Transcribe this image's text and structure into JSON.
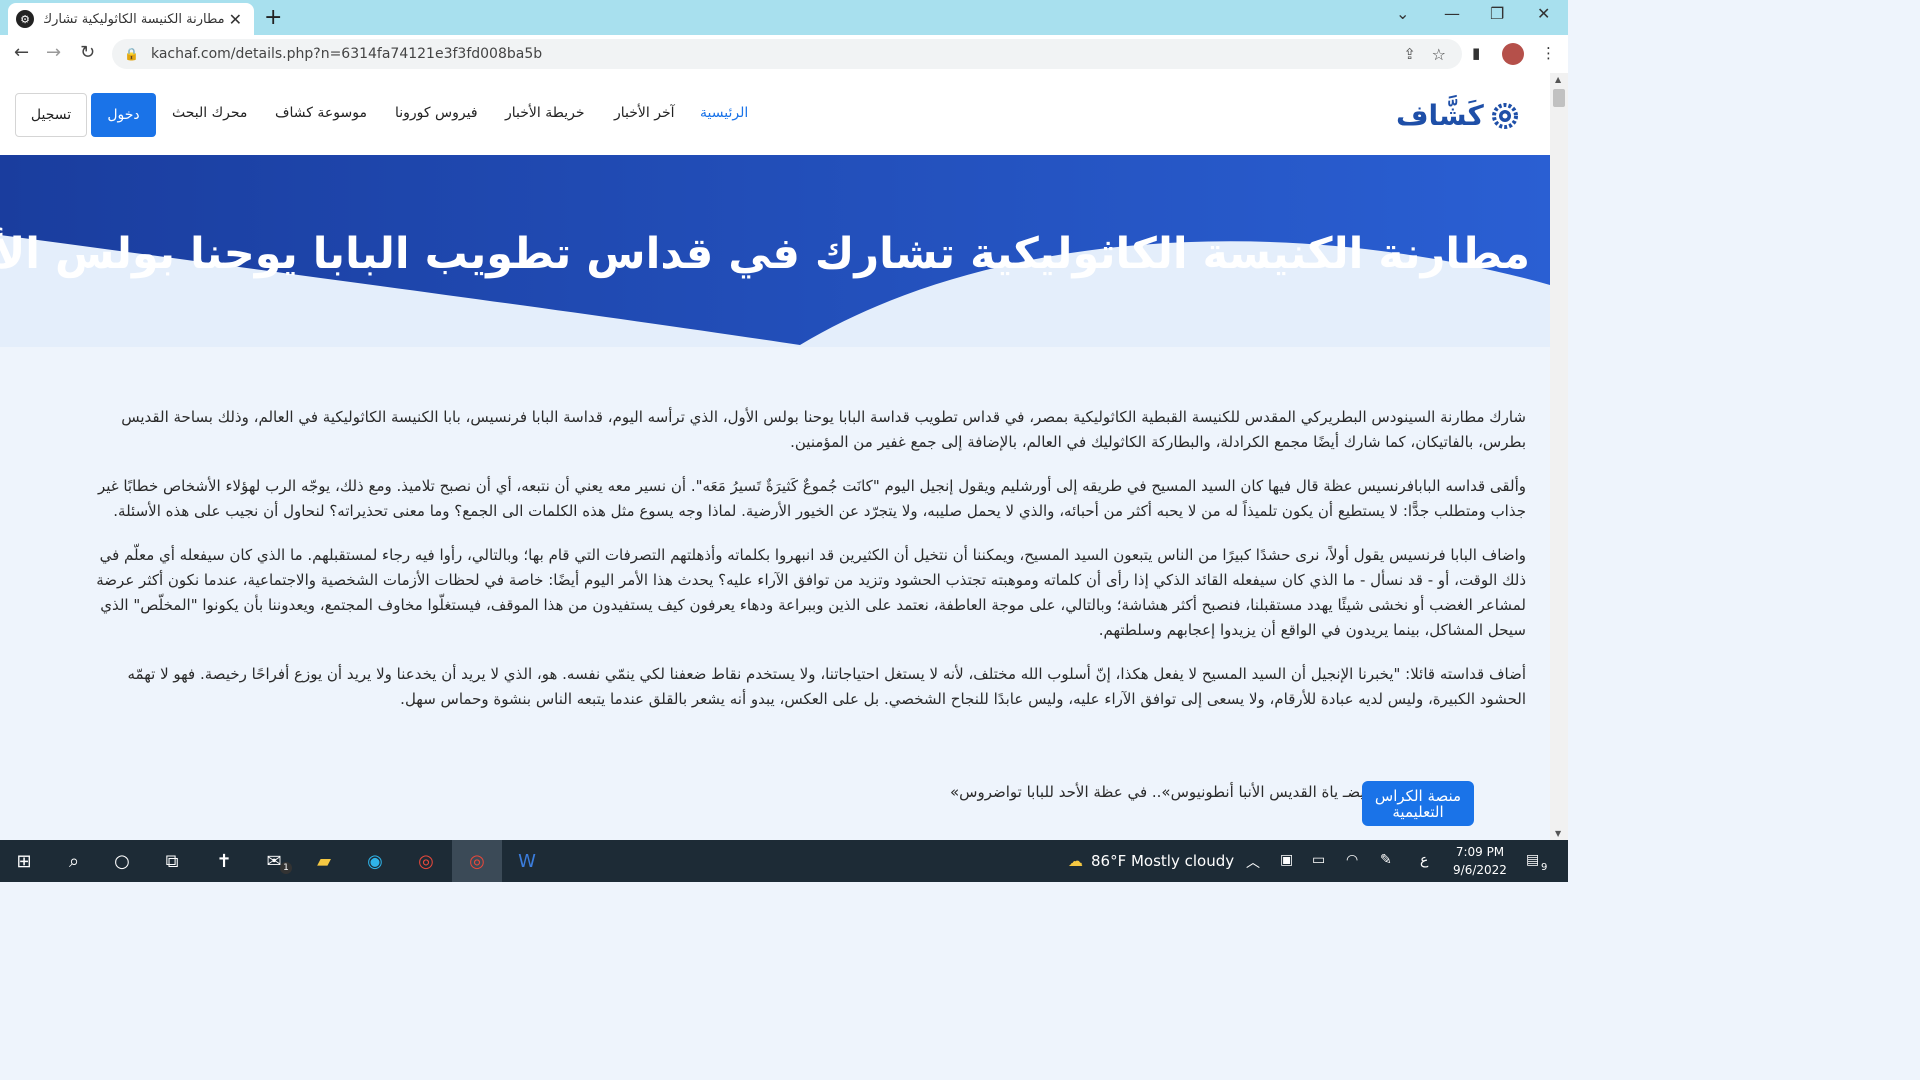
{
  "browser": {
    "tab_title": "مطارنة الكنيسة الكاثوليكية تشارك ف",
    "url": "kachaf.com/details.php?n=6314fa74121e3f3fd008ba5b"
  },
  "site": {
    "logo_text": "كَشَّاف",
    "nav": [
      {
        "label": "الرئيسية"
      },
      {
        "label": "آخر الأخبار"
      },
      {
        "label": "خريطة الأخبار"
      },
      {
        "label": "فيروس كورونا"
      },
      {
        "label": "موسوعة كشاف"
      },
      {
        "label": "محرك البحث"
      }
    ],
    "login_label": "دخول",
    "register_label": "تسجيل"
  },
  "article": {
    "title": "مطارنة الكنيسة الكاثوليكية تشارك في قداس تطويب البابا يوحنا بولس الأول",
    "paragraphs": [
      "شارك مطارنة السينودس البطريركي المقدس للكنيسة القبطية الكاثوليكية بمصر، في قداس تطويب قداسة البابا يوحنا بولس الأول، الذي ترأسه اليوم، قداسة البابا فرنسيس، بابا الكنيسة الكاثوليكية في العالم، وذلك بساحة القديس بطرس، بالفاتيكان، كما شارك أيضًا مجمع الكرادلة، والبطاركة الكاثوليك في العالم، بالإضافة إلى جمع غفير من المؤمنين.",
      "وألقى قداسه البابافرنسيس عظة قال فيها كان السيد المسيح في طريقه إلى أورشليم ويقول إنجيل اليوم \"كانَت جُموعٌ كَثيرَةٌ تَسيرُ مَعَه\". أن نسير معه يعني أن نتبعه، أي أن نصبح تلاميذ. ومع ذلك، يوجّه الرب لهؤلاء الأشخاص خطابًا غير جذاب ومتطلب جدًّا: لا يستطيع أن يكون تلميذاً له من لا يحبه أكثر من أحبائه، والذي لا يحمل صليبه، ولا يتجرّد عن الخيور الأرضية. لماذا وجه يسوع مثل هذه الكلمات الى الجمع؟ وما معنى تحذيراته؟ لنحاول أن نجيب على هذه الأسئلة.",
      "واضاف البابا فرنسيس يقول أولاً، نرى حشدًا كبيرًا من الناس يتبعون السيد المسيح، ويمكننا أن نتخيل أن الكثيرين قد انبهروا بكلماته وأذهلتهم التصرفات التي قام بها؛ وبالتالي، رأوا فيه رجاء لمستقبلهم. ما الذي كان سيفعله أي معلّم في ذلك الوقت، أو - قد نسأل - ما الذي كان سيفعله القائد الذكي إذا رأى أن كلماته وموهبته تجتذب الحشود وتزيد من توافق الآراء عليه؟ يحدث هذا الأمر اليوم أيضًا: خاصة في لحظات الأزمات الشخصية والاجتماعية، عندما نكون أكثر عرضة لمشاعر الغضب أو نخشى شيئًا يهدد مستقبلنا، فنصبح أكثر هشاشة؛ وبالتالي، على موجة العاطفة، نعتمد على الذين وببراعة ودهاء يعرفون كيف يستفيدون من هذا الموقف، فيستغلّوا مخاوف المجتمع، ويعدوننا بأن يكونوا \"المخلّص\" الذي سيحل المشاكل، بينما يريدون في الواقع أن يزيدوا إعجابهم وسلطتهم.",
      "أضاف قداسته قائلا: \"يخبرنا الإنجيل أن السيد المسيح لا يفعل هكذا، إنّ أسلوب الله مختلف، لأنه لا يستغل احتياجاتنا، ولا يستخدم نقاط ضعفنا لكي ينمّي نفسه. هو، الذي لا يريد أن يخدعنا ولا يريد أن يوزع أفراحًا رخيصة. فهو لا تهمّه الحشود الكبيرة، وليس لديه عبادة للأرقام، ولا يسعى إلى توافق الآراء عليه، وليس عابدًا للنجاح الشخصي. بل على العكس، يبدو أنه يشعر بالقلق عندما يتبعه الناس بنشوة وحماس سهل."
    ],
    "related": "اقرأ أيضـ            ياة القديس الأنبا أنطونيوس».. في عظة الأحد للبابا تواضروس»",
    "float_button": "منصة الكراس التعليمية"
  },
  "taskbar": {
    "weather": "86°F  Mostly cloudy",
    "time": "7:09 PM",
    "date": "9/6/2022",
    "lang": "ع",
    "mail_badge": "1",
    "notif_badge": "9"
  },
  "colors": {
    "hero_dark": "#1a3d9e",
    "hero_light": "#2a5fd3",
    "accent": "#1a73e8",
    "tabstrip": "#a8e0ee",
    "taskbar": "#1d2b36"
  }
}
